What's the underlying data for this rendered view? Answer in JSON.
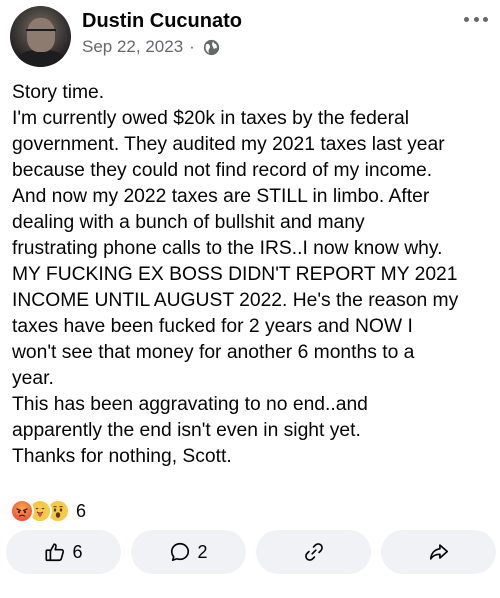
{
  "post": {
    "author": "Dustin Cucunato",
    "date": "Sep 22, 2023",
    "separator": "·",
    "privacy_icon": "globe-icon",
    "lines": [
      "Story time.",
      "I'm currently owed $20k in taxes by the federal",
      "government. They audited my 2021 taxes last year",
      "because they could not find record of my income.",
      "And now my 2022 taxes are STILL in limbo. After",
      "dealing with a bunch of bullshit and many",
      "frustrating phone calls to the IRS..I now know why.",
      "MY FUCKING EX BOSS DIDN'T REPORT MY 2021",
      "INCOME UNTIL AUGUST 2022. He's the reason my",
      "taxes have been fucked for 2 years and NOW I",
      "won't see that money for another 6 months to a",
      "year.",
      "This has been aggravating to no end..and",
      "apparently the end isn't even in sight yet.",
      "Thanks for nothing, Scott."
    ]
  },
  "reactions": {
    "icons": [
      "angry-emoji-icon",
      "care-emoji-icon",
      "wow-emoji-icon"
    ],
    "count": "6"
  },
  "actions": {
    "like_count": "6",
    "comment_count": "2"
  },
  "colors": {
    "text": "#050505",
    "secondary": "#65676b",
    "button_bg": "#f0f2f5"
  }
}
